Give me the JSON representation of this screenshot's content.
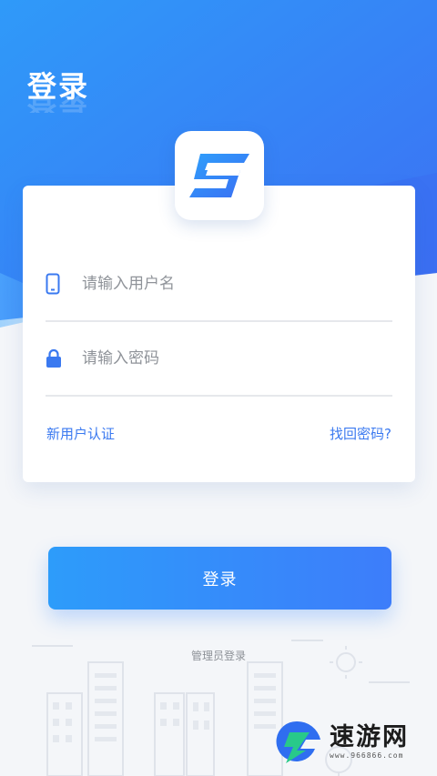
{
  "header": {
    "title": "登录"
  },
  "logo": {
    "icon": "app-s-logo-icon"
  },
  "form": {
    "username": {
      "placeholder": "请输入用户名",
      "value": "",
      "icon": "phone-icon"
    },
    "password": {
      "placeholder": "请输入密码",
      "value": "",
      "icon": "lock-icon"
    },
    "new_user_link": "新用户认证",
    "forgot_password_link": "找回密码?"
  },
  "actions": {
    "login_button": "登录",
    "admin_login_link": "管理员登录"
  },
  "watermark": {
    "title": "速游网",
    "subtitle": "www.966866.com"
  },
  "colors": {
    "primary": "#3a79f0",
    "header_gradient_start": "#2f8ef8",
    "header_gradient_end": "#3e6ff2",
    "button_gradient_start": "#2d9cfa",
    "button_gradient_end": "#3d7dfa",
    "placeholder": "#8f9399"
  }
}
